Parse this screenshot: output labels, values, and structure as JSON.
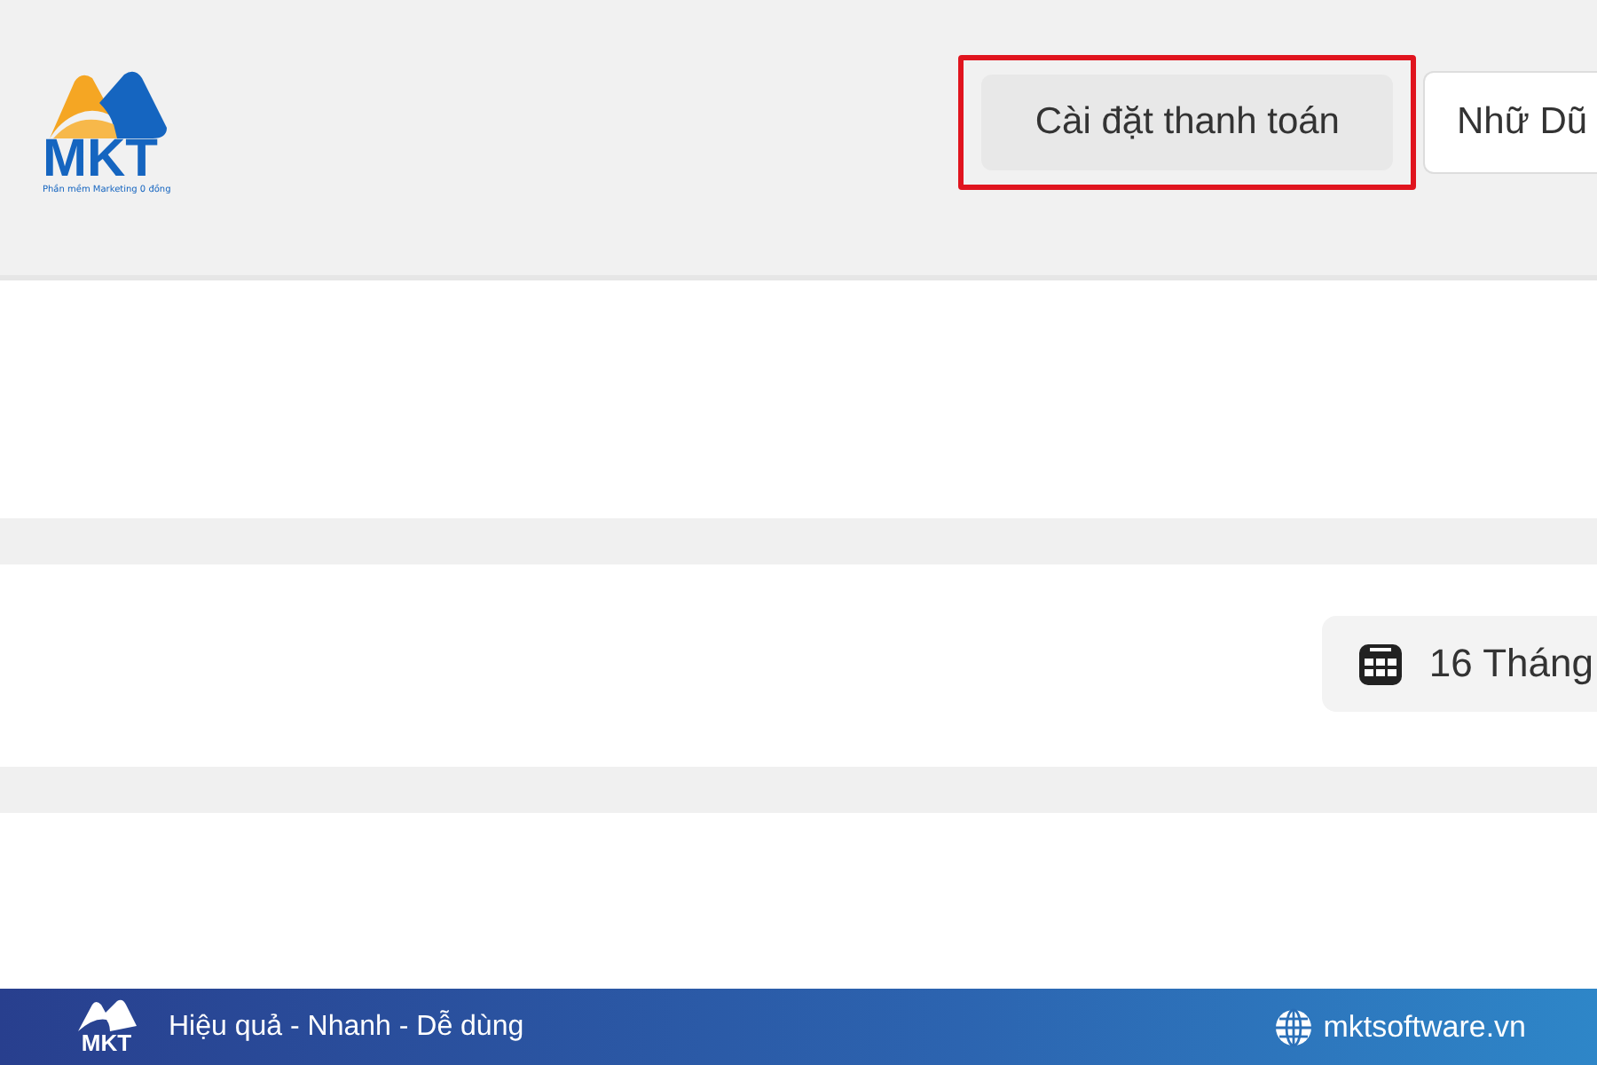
{
  "header": {
    "logo": {
      "text": "MKT",
      "tagline": "Phần mềm Marketing 0 đồng"
    },
    "payment_settings_button": {
      "label": "Cài đặt thanh toán",
      "highlighted": true
    },
    "user_button": {
      "label": "Nhữ Dũ"
    }
  },
  "date_button": {
    "label": "16 Tháng"
  },
  "footer": {
    "logo": {
      "text": "MKT"
    },
    "slogan": "Hiệu quả - Nhanh - Dễ dùng",
    "website": "mktsoftware.vn"
  }
}
